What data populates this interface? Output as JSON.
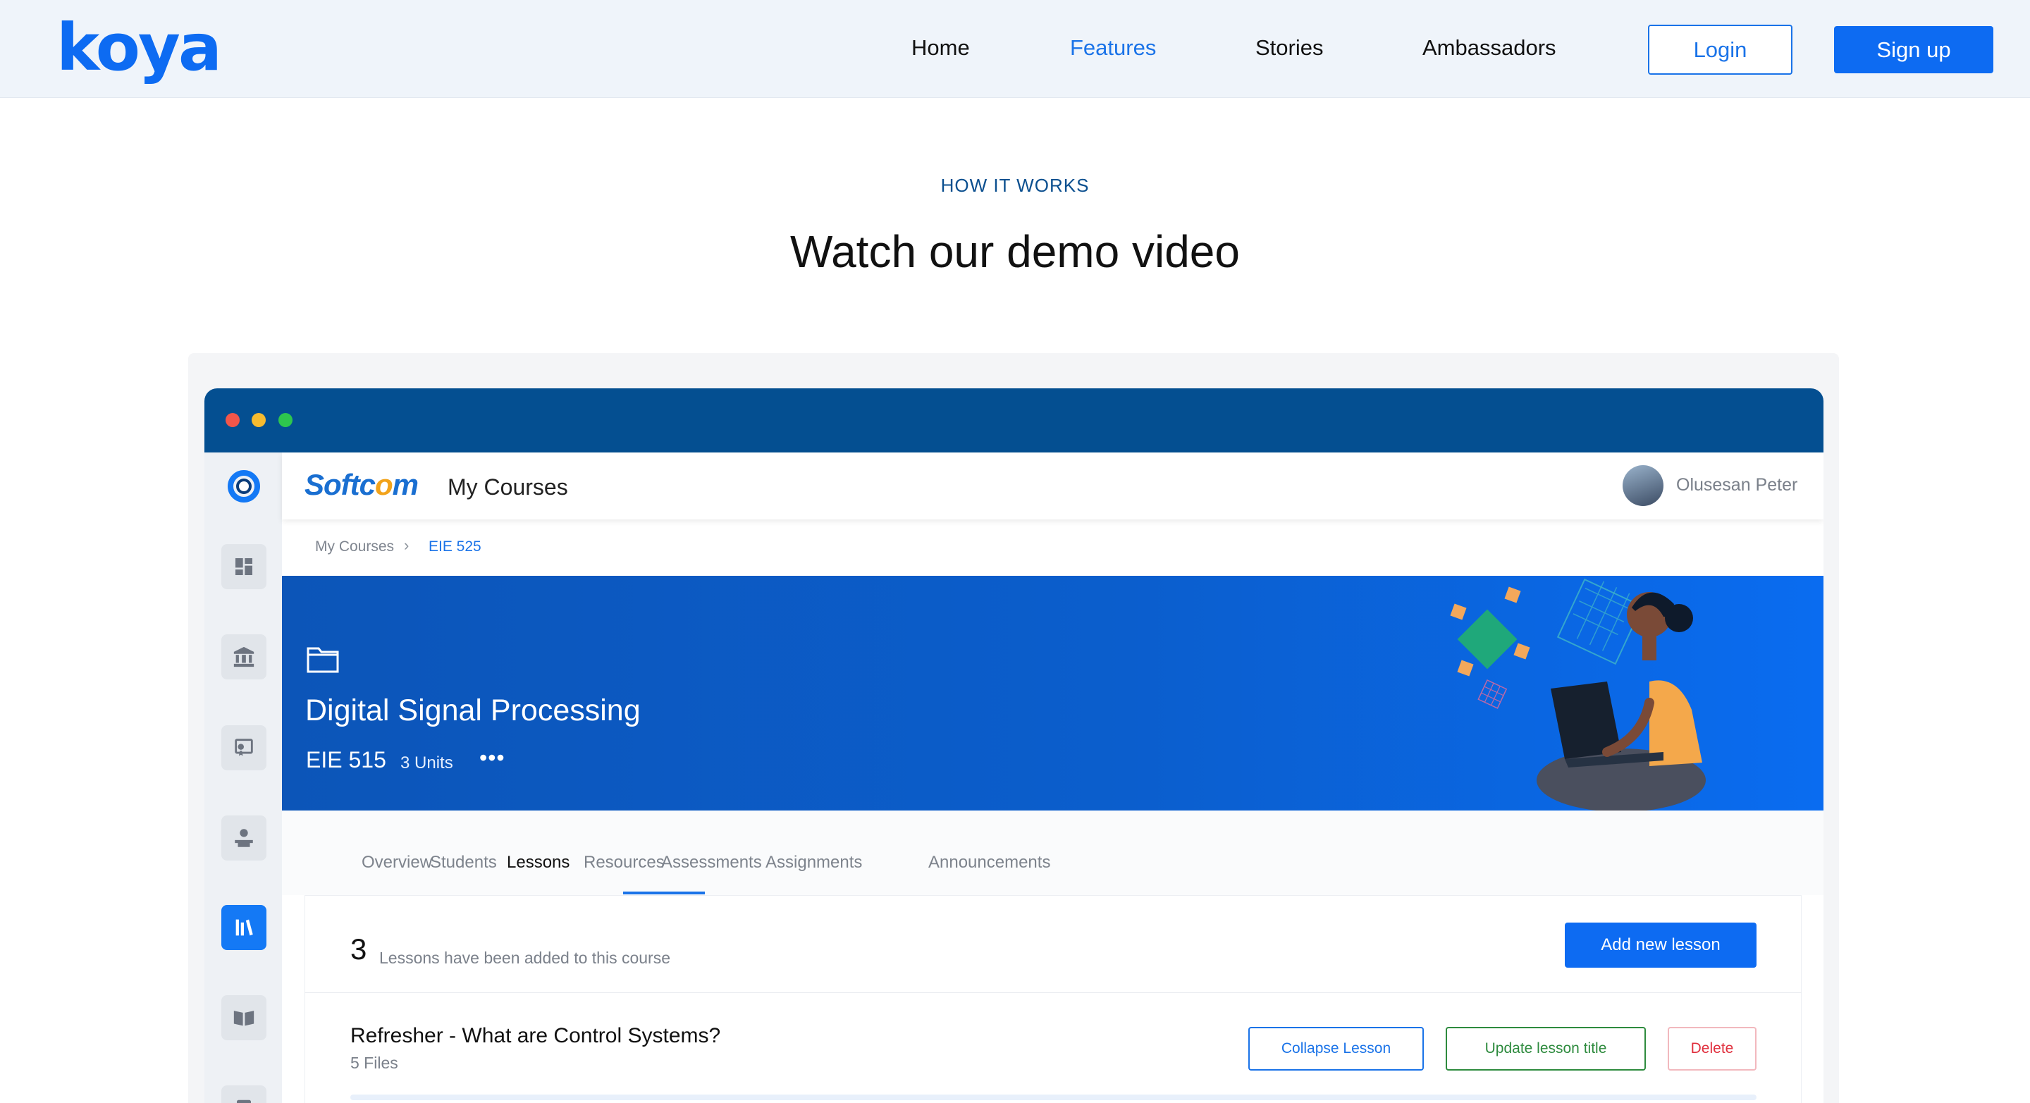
{
  "nav": {
    "logo": "koya",
    "links": [
      "Home",
      "Features",
      "Stories",
      "Ambassadors"
    ],
    "active_link": "Features",
    "login_label": "Login",
    "signup_label": "Sign up"
  },
  "hero": {
    "eyebrow": "HOW IT WORKS",
    "title": "Watch our demo video"
  },
  "demo": {
    "window_dots": [
      "#f2564a",
      "#f7bb2f",
      "#2ec64e"
    ],
    "brand": {
      "prefix": "Softc",
      "accent": "o",
      "suffix": "m"
    },
    "app_title": "My Courses",
    "user_name": "Olusesan Peter",
    "user_caret": "▾",
    "sidebar_icons": [
      "app-logo-icon",
      "dashboard-icon",
      "institution-icon",
      "certificate-icon",
      "teacher-icon",
      "library-icon",
      "book-icon",
      "document-icon"
    ],
    "breadcrumb": {
      "root": "My Courses",
      "separator": "›",
      "current": "EIE 525"
    },
    "course": {
      "title": "Digital Signal Processing",
      "code": "EIE 515",
      "units": "3 Units",
      "more": "•••"
    },
    "tabs": [
      "Overview",
      "Students",
      "Lessons",
      "Resources",
      "Assessments",
      "Assignments",
      "Announcements"
    ],
    "active_tab": "Lessons",
    "lessons": {
      "count": "3",
      "note": "Lessons have been added to this course",
      "add_label": "Add new lesson",
      "items": [
        {
          "title": "Refresher - What are Control Systems?",
          "files": "5 Files",
          "collapse_label": "Collapse Lesson",
          "update_label": "Update lesson title",
          "delete_label": "Delete"
        }
      ]
    }
  }
}
